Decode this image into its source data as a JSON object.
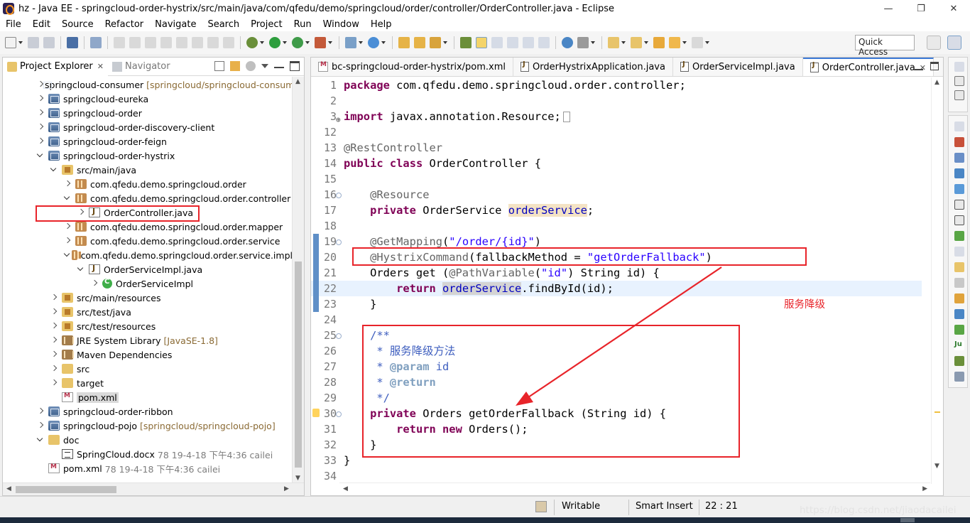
{
  "window": {
    "title": "hz - Java EE - springcloud-order-hystrix/src/main/java/com/qfedu/demo/springcloud/order/controller/OrderController.java - Eclipse",
    "controls": {
      "minimize": "—",
      "restore": "❐",
      "close": "✕"
    }
  },
  "menubar": [
    "File",
    "Edit",
    "Source",
    "Refactor",
    "Navigate",
    "Search",
    "Project",
    "Run",
    "Window",
    "Help"
  ],
  "toolbar": {
    "quick_access": "Quick Access"
  },
  "explorer": {
    "tabs": [
      {
        "label": "Project Explorer",
        "close": "✕"
      },
      {
        "label": "Navigator"
      }
    ],
    "tree": [
      {
        "label": "springcloud-consumer",
        "decoration": "[springcloud/springcloud-consumer]",
        "icon": "project-icon",
        "depth": 0,
        "arrow": "right"
      },
      {
        "label": "springcloud-eureka",
        "icon": "project-icon",
        "depth": 0,
        "arrow": "right"
      },
      {
        "label": "springcloud-order",
        "icon": "project-icon",
        "depth": 0,
        "arrow": "right"
      },
      {
        "label": "springcloud-order-discovery-client",
        "icon": "project-icon",
        "depth": 0,
        "arrow": "right"
      },
      {
        "label": "springcloud-order-feign",
        "icon": "project-icon",
        "depth": 0,
        "arrow": "right"
      },
      {
        "label": "springcloud-order-hystrix",
        "icon": "project-icon",
        "depth": 0,
        "arrow": "down"
      },
      {
        "label": "src/main/java",
        "icon": "source-folder-icon",
        "depth": 1,
        "arrow": "down"
      },
      {
        "label": "com.qfedu.demo.springcloud.order",
        "icon": "package-icon",
        "depth": 2,
        "arrow": "right"
      },
      {
        "label": "com.qfedu.demo.springcloud.order.controller",
        "icon": "package-icon",
        "depth": 2,
        "arrow": "down"
      },
      {
        "label": "OrderController.java",
        "icon": "java-file-icon",
        "depth": 3,
        "arrow": "right"
      },
      {
        "label": "com.qfedu.demo.springcloud.order.mapper",
        "icon": "package-icon",
        "depth": 2,
        "arrow": "right"
      },
      {
        "label": "com.qfedu.demo.springcloud.order.service",
        "icon": "package-icon",
        "depth": 2,
        "arrow": "right"
      },
      {
        "label": "com.qfedu.demo.springcloud.order.service.impl",
        "icon": "package-icon",
        "depth": 2,
        "arrow": "down"
      },
      {
        "label": "OrderServiceImpl.java",
        "icon": "java-file-icon",
        "depth": 3,
        "arrow": "down"
      },
      {
        "label": "OrderServiceImpl",
        "icon": "class-icon",
        "depth": 4,
        "arrow": "right"
      },
      {
        "label": "src/main/resources",
        "icon": "source-folder-icon",
        "depth": 1,
        "arrow": "right"
      },
      {
        "label": "src/test/java",
        "icon": "source-folder-icon",
        "depth": 1,
        "arrow": "right"
      },
      {
        "label": "src/test/resources",
        "icon": "source-folder-icon",
        "depth": 1,
        "arrow": "right"
      },
      {
        "label": "JRE System Library",
        "decoration": "[JavaSE-1.8]",
        "icon": "library-icon",
        "depth": 1,
        "arrow": "right"
      },
      {
        "label": "Maven Dependencies",
        "icon": "library-icon",
        "depth": 1,
        "arrow": "right"
      },
      {
        "label": "src",
        "icon": "folder-icon",
        "depth": 1,
        "arrow": "right"
      },
      {
        "label": "target",
        "icon": "folder-icon",
        "depth": 1,
        "arrow": "right"
      },
      {
        "label": "pom.xml",
        "icon": "xml-file-icon",
        "depth": 1,
        "arrow": "none",
        "selected": true
      },
      {
        "label": "springcloud-order-ribbon",
        "icon": "project-icon",
        "depth": 0,
        "arrow": "right"
      },
      {
        "label": "springcloud-pojo",
        "decoration": "[springcloud/springcloud-pojo]",
        "icon": "project-icon",
        "depth": 0,
        "arrow": "right"
      },
      {
        "label": "doc",
        "icon": "folder-icon",
        "depth": 0,
        "arrow": "down"
      },
      {
        "label": "SpringCloud.docx",
        "decoration": "78  19-4-18 下午4:36  cailei",
        "icon": "document-icon",
        "depth": 1,
        "arrow": "none"
      },
      {
        "label": "pom.xml",
        "decoration": "78  19-4-18 下午4:36  cailei",
        "icon": "xml-file-icon",
        "depth": 0,
        "arrow": "none"
      }
    ]
  },
  "editor": {
    "tabs": [
      {
        "label": "bc-springcloud-order-hystrix/pom.xml",
        "icon": "xml-file-icon"
      },
      {
        "label": "OrderHystrixApplication.java",
        "icon": "java-file-icon"
      },
      {
        "label": "OrderServiceImpl.java",
        "icon": "java-file-icon"
      },
      {
        "label": "OrderController.java",
        "icon": "java-file-icon",
        "active": true,
        "close": "✕"
      }
    ],
    "lines": [
      {
        "n": "1",
        "tokens": [
          [
            "kw",
            "package"
          ],
          [
            "",
            " com.qfedu.demo.springcloud.order.controller;"
          ]
        ]
      },
      {
        "n": "2",
        "tokens": []
      },
      {
        "n": "3",
        "tokens": [
          [
            "kw",
            "import"
          ],
          [
            "",
            " javax.annotation.Resource;"
          ]
        ],
        "folded": true
      },
      {
        "n": "12",
        "tokens": []
      },
      {
        "n": "13",
        "tokens": [
          [
            "an",
            "@RestController"
          ]
        ]
      },
      {
        "n": "14",
        "tokens": [
          [
            "kw",
            "public"
          ],
          [
            "",
            " "
          ],
          [
            "kw",
            "class"
          ],
          [
            "",
            " OrderController {"
          ]
        ]
      },
      {
        "n": "15",
        "tokens": []
      },
      {
        "n": "16",
        "tokens": [
          [
            "",
            "    "
          ],
          [
            "an",
            "@Resource"
          ]
        ],
        "fold": true
      },
      {
        "n": "17",
        "tokens": [
          [
            "",
            "    "
          ],
          [
            "kw",
            "private"
          ],
          [
            "",
            " OrderService "
          ],
          [
            "fld hl",
            "orderService"
          ],
          [
            "",
            ";"
          ]
        ]
      },
      {
        "n": "18",
        "tokens": []
      },
      {
        "n": "19",
        "tokens": [
          [
            "",
            "    "
          ],
          [
            "an",
            "@GetMapping"
          ],
          [
            "",
            "("
          ],
          [
            "st",
            "\"/order/{id}\""
          ],
          [
            "",
            ")"
          ]
        ],
        "fold": true,
        "mark": true
      },
      {
        "n": "20",
        "tokens": [
          [
            "",
            "    "
          ],
          [
            "an",
            "@HystrixCommand"
          ],
          [
            "",
            "(fallbackMethod = "
          ],
          [
            "st",
            "\"getOrderFallback\""
          ],
          [
            "",
            ")"
          ]
        ],
        "mark": true
      },
      {
        "n": "21",
        "tokens": [
          [
            "",
            "    Orders get ("
          ],
          [
            "an",
            "@PathVariable"
          ],
          [
            "",
            "("
          ],
          [
            "st",
            "\"id\""
          ],
          [
            "",
            ") String id) {"
          ]
        ],
        "mark": true
      },
      {
        "n": "22",
        "tokens": [
          [
            "",
            "        "
          ],
          [
            "kw",
            "return"
          ],
          [
            "",
            " "
          ],
          [
            "fld hl2",
            "orderService"
          ],
          [
            "",
            ".findById(id);"
          ]
        ],
        "mark": true,
        "current": true
      },
      {
        "n": "23",
        "tokens": [
          [
            "",
            "    }"
          ]
        ],
        "mark": true
      },
      {
        "n": "24",
        "tokens": []
      },
      {
        "n": "25",
        "tokens": [
          [
            "",
            "    "
          ],
          [
            "cm",
            "/**"
          ]
        ],
        "fold": true
      },
      {
        "n": "26",
        "tokens": [
          [
            "cm",
            "     * 服务降级方法"
          ]
        ]
      },
      {
        "n": "27",
        "tokens": [
          [
            "cm",
            "     * "
          ],
          [
            "tg",
            "@param"
          ],
          [
            "cm",
            " id"
          ]
        ]
      },
      {
        "n": "28",
        "tokens": [
          [
            "cm",
            "     * "
          ],
          [
            "tg",
            "@return"
          ]
        ]
      },
      {
        "n": "29",
        "tokens": [
          [
            "cm",
            "     */"
          ]
        ]
      },
      {
        "n": "30",
        "tokens": [
          [
            "",
            "    "
          ],
          [
            "kw",
            "private"
          ],
          [
            "",
            " Orders getOrderFallback (String id) {"
          ]
        ],
        "fold": true,
        "warn": true
      },
      {
        "n": "31",
        "tokens": [
          [
            "",
            "        "
          ],
          [
            "kw",
            "return"
          ],
          [
            "",
            " "
          ],
          [
            "kw",
            "new"
          ],
          [
            "",
            " Orders();"
          ]
        ]
      },
      {
        "n": "32",
        "tokens": [
          [
            "",
            "    }"
          ]
        ]
      },
      {
        "n": "33",
        "tokens": [
          [
            "",
            "}"
          ]
        ]
      },
      {
        "n": "34",
        "tokens": []
      }
    ],
    "annotation_label": "服务降级"
  },
  "statusbar": {
    "mode": "Writable",
    "insert": "Smart Insert",
    "position": "22 : 21"
  },
  "watermark": "https://blog.csdn.net/jiaodacailei",
  "colors": {
    "annotation_red": "#e8242a",
    "keyword": "#7f0055",
    "string": "#2a00ff",
    "javadoc": "#3f5fbf"
  }
}
